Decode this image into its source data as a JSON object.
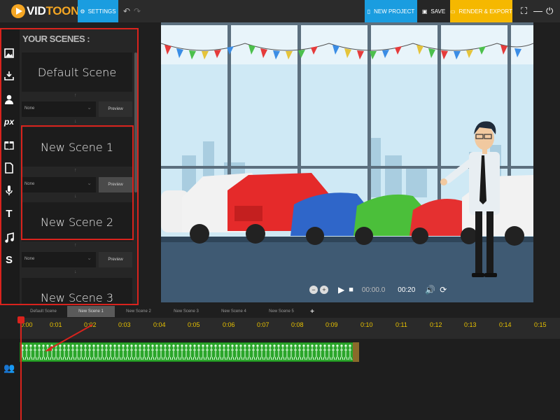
{
  "app": {
    "logo_part1": "VID",
    "logo_part2": "TOON",
    "settings_label": "SETTINGS",
    "new_project_label": "NEW PROJECT",
    "save_label": "SAVE",
    "render_label": "RENDER & EXPORT"
  },
  "colors": {
    "accent_blue": "#1a9de0",
    "accent_yellow": "#f5b800",
    "highlight_red": "#d9231d",
    "clip_green": "#2aa52a"
  },
  "sidebar": {
    "icons": [
      "image-icon",
      "download-icon",
      "user-icon",
      "px-icon",
      "gift-icon",
      "file-icon",
      "microphone-icon",
      "text-icon",
      "music-icon",
      "s-icon"
    ],
    "px_label": "px",
    "text_label": "T",
    "s_label": "S"
  },
  "scenes_panel": {
    "title": "YOUR SCENES :",
    "scenes": [
      {
        "name": "Default Scene",
        "transition": "None",
        "preview": "Preview"
      },
      {
        "name": "New Scene 1",
        "transition": "None",
        "preview": "Preview"
      },
      {
        "name": "New Scene 2",
        "transition": "None",
        "preview": "Preview"
      },
      {
        "name": "New Scene 3"
      }
    ]
  },
  "player": {
    "current_time": "00:00.0",
    "total_time": "00:20"
  },
  "tabs": [
    "Default Scene",
    "New Scene 1",
    "New Scene 2",
    "New Scene 3",
    "New Scene 4",
    "New Scene 5"
  ],
  "active_tab": "New Scene 1",
  "timeline": {
    "ticks": [
      "0:00",
      "0:01",
      "0:02",
      "0:03",
      "0:04",
      "0:05",
      "0:06",
      "0:07",
      "0:08",
      "0:09",
      "0:10",
      "0:11",
      "0:12",
      "0:13",
      "0:14",
      "0:15"
    ]
  }
}
